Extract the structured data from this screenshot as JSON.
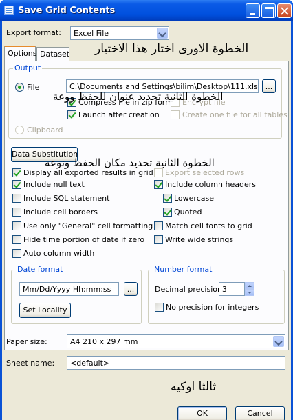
{
  "window": {
    "title": "Save Grid Contents"
  },
  "export_format": {
    "label": "Export format:",
    "value": "Excel File"
  },
  "tabs": [
    {
      "label": "Options",
      "active": true
    },
    {
      "label": "Dataset",
      "active": false
    }
  ],
  "output": {
    "group_title": "Output",
    "file_label": "File",
    "file_selected": true,
    "file_path": "C:\\Documents and Settings\\bilim\\Desktop\\111.xls",
    "browse_label": "...",
    "compress_label": "Compress file in zip format",
    "compress_checked": true,
    "encrypt_label": "Encrypt file",
    "launch_label": "Launch after creation",
    "launch_checked": true,
    "one_file_label": "Create one file for all tables",
    "clipboard_label": "Clipboard"
  },
  "data_substitution_label": "Data Substitution",
  "options_left": [
    {
      "label": "Display all exported results in grid",
      "checked": true
    },
    {
      "label": "Include null text",
      "checked": true
    },
    {
      "label": "Include SQL statement",
      "checked": false
    },
    {
      "label": "Include cell borders",
      "checked": false
    },
    {
      "label": "Use only \"General\" cell formatting",
      "checked": false
    },
    {
      "label": "Hide time portion of date if zero",
      "checked": false
    },
    {
      "label": "Auto column width",
      "checked": false
    }
  ],
  "options_right": [
    {
      "label": "Export selected rows",
      "checked": false,
      "disabled": true
    },
    {
      "label": "Include column headers",
      "checked": true
    },
    {
      "label": "Lowercase",
      "checked": true
    },
    {
      "label": "Quoted",
      "checked": true
    },
    {
      "label": "Match cell fonts to grid",
      "checked": false
    },
    {
      "label": "Write wide strings",
      "checked": false
    }
  ],
  "date_format": {
    "group_title": "Date format",
    "value": "Mm/Dd/Yyyy Hh:mm:ss",
    "browse_label": "...",
    "locality_label": "Set Locality"
  },
  "number_format": {
    "group_title": "Number format",
    "precision_label": "Decimal precision:",
    "precision_value": "3",
    "no_precision_label": "No precision for integers"
  },
  "paper_size": {
    "label": "Paper size:",
    "value": "A4 210 x 297 mm"
  },
  "sheet_name": {
    "label": "Sheet name:",
    "value": "<default>"
  },
  "annotations": {
    "step1": "الخطوة الاورى اختار هذا الاختيار",
    "step2": "الخطوة الثانية تحديد عنوان للحفظ ووعة",
    "step3": "الخطوة الثانية تحديد مكان الحفظ ونوعه",
    "step4": "ثالثا اوكيه"
  },
  "buttons": {
    "ok": "OK",
    "cancel": "Cancel"
  }
}
